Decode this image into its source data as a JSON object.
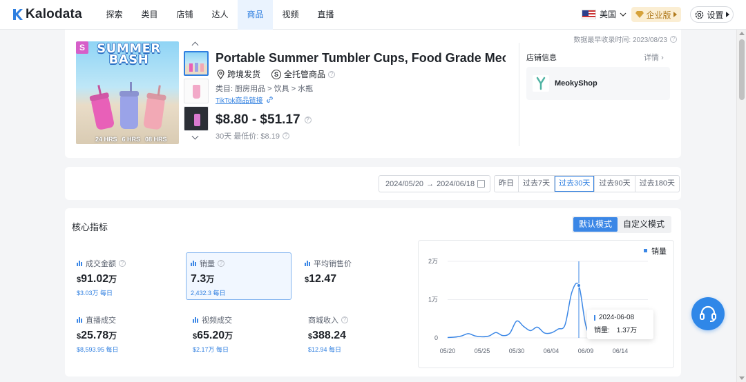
{
  "app": {
    "brand": "Kalodata"
  },
  "nav": {
    "items": [
      "探索",
      "类目",
      "店铺",
      "达人",
      "商品",
      "视频",
      "直播"
    ],
    "active_index": 4
  },
  "header_right": {
    "region": "美国",
    "enterprise": "企业版",
    "settings": "设置"
  },
  "product": {
    "update_time": "数据最早收录时间: 2023/08/23",
    "image_badge": "S",
    "image_banner": "SUMMER BASH",
    "image_hours": [
      "24 HRS",
      "6 HRS",
      "08 HRS"
    ],
    "title": "Portable Summer Tumbler Cups, Food Grade Meo…",
    "shipping": "跨境发货",
    "managed": "全托管商品",
    "category": "类目: 厨房用品 > 饮具 > 水瓶",
    "tiktok_link": "TikTok商品链接",
    "price_range": "$8.80 - $51.17",
    "lowest_price": "30天 最低价: $8.19"
  },
  "shop": {
    "section_label": "店铺信息",
    "detail_link": "详情",
    "name": "MeokyShop"
  },
  "date_filter": {
    "start": "2024/05/20",
    "end": "2024/06/18",
    "presets": [
      "昨日",
      "过去7天",
      "过去30天",
      "过去90天",
      "过去180天"
    ],
    "active_index": 2
  },
  "metrics": {
    "section_title": "核心指标",
    "modes": [
      "默认模式",
      "自定义模式"
    ],
    "active_mode": 0,
    "items": [
      {
        "label": "成交金额",
        "value": "91.02",
        "unit": "万",
        "sub": "$3.03万 每日"
      },
      {
        "label": "销量",
        "value": "7.3",
        "unit": "万",
        "sub": "2,432.3 每日"
      },
      {
        "label": "平均销售价",
        "value": "12.47",
        "unit": "",
        "sub": ""
      },
      {
        "label": "直播成交",
        "value": "25.78",
        "unit": "万",
        "sub": "$8,593.95 每日"
      },
      {
        "label": "视频成交",
        "value": "65.20",
        "unit": "万",
        "sub": "$2.17万 每日"
      },
      {
        "label": "商城收入",
        "value": "388.24",
        "unit": "",
        "sub": "$12.94 每日"
      }
    ]
  },
  "chart_data": {
    "type": "line",
    "legend": "销量",
    "x_ticks": [
      "05/20",
      "05/25",
      "05/30",
      "06/04",
      "06/09",
      "06/14"
    ],
    "y_ticks": [
      "0",
      "1万",
      "2万"
    ],
    "ylim": [
      0,
      20000
    ],
    "x": [
      "05/20",
      "05/21",
      "05/22",
      "05/23",
      "05/24",
      "05/25",
      "05/26",
      "05/27",
      "05/28",
      "05/29",
      "05/30",
      "05/31",
      "06/01",
      "06/02",
      "06/03",
      "06/04",
      "06/05",
      "06/06",
      "06/07",
      "06/08",
      "06/09",
      "06/10",
      "06/11",
      "06/12",
      "06/13",
      "06/14",
      "06/15",
      "06/16",
      "06/17",
      "06/18"
    ],
    "values": [
      100,
      200,
      500,
      1100,
      500,
      300,
      500,
      1400,
      600,
      1200,
      4400,
      3000,
      1900,
      2800,
      1300,
      1300,
      2300,
      3400,
      12000,
      13700,
      3300,
      0,
      0,
      0,
      0,
      0,
      0,
      0,
      0,
      0
    ],
    "tooltip": {
      "date": "2024-06-08",
      "label": "销量:",
      "value": "1.37万"
    }
  }
}
